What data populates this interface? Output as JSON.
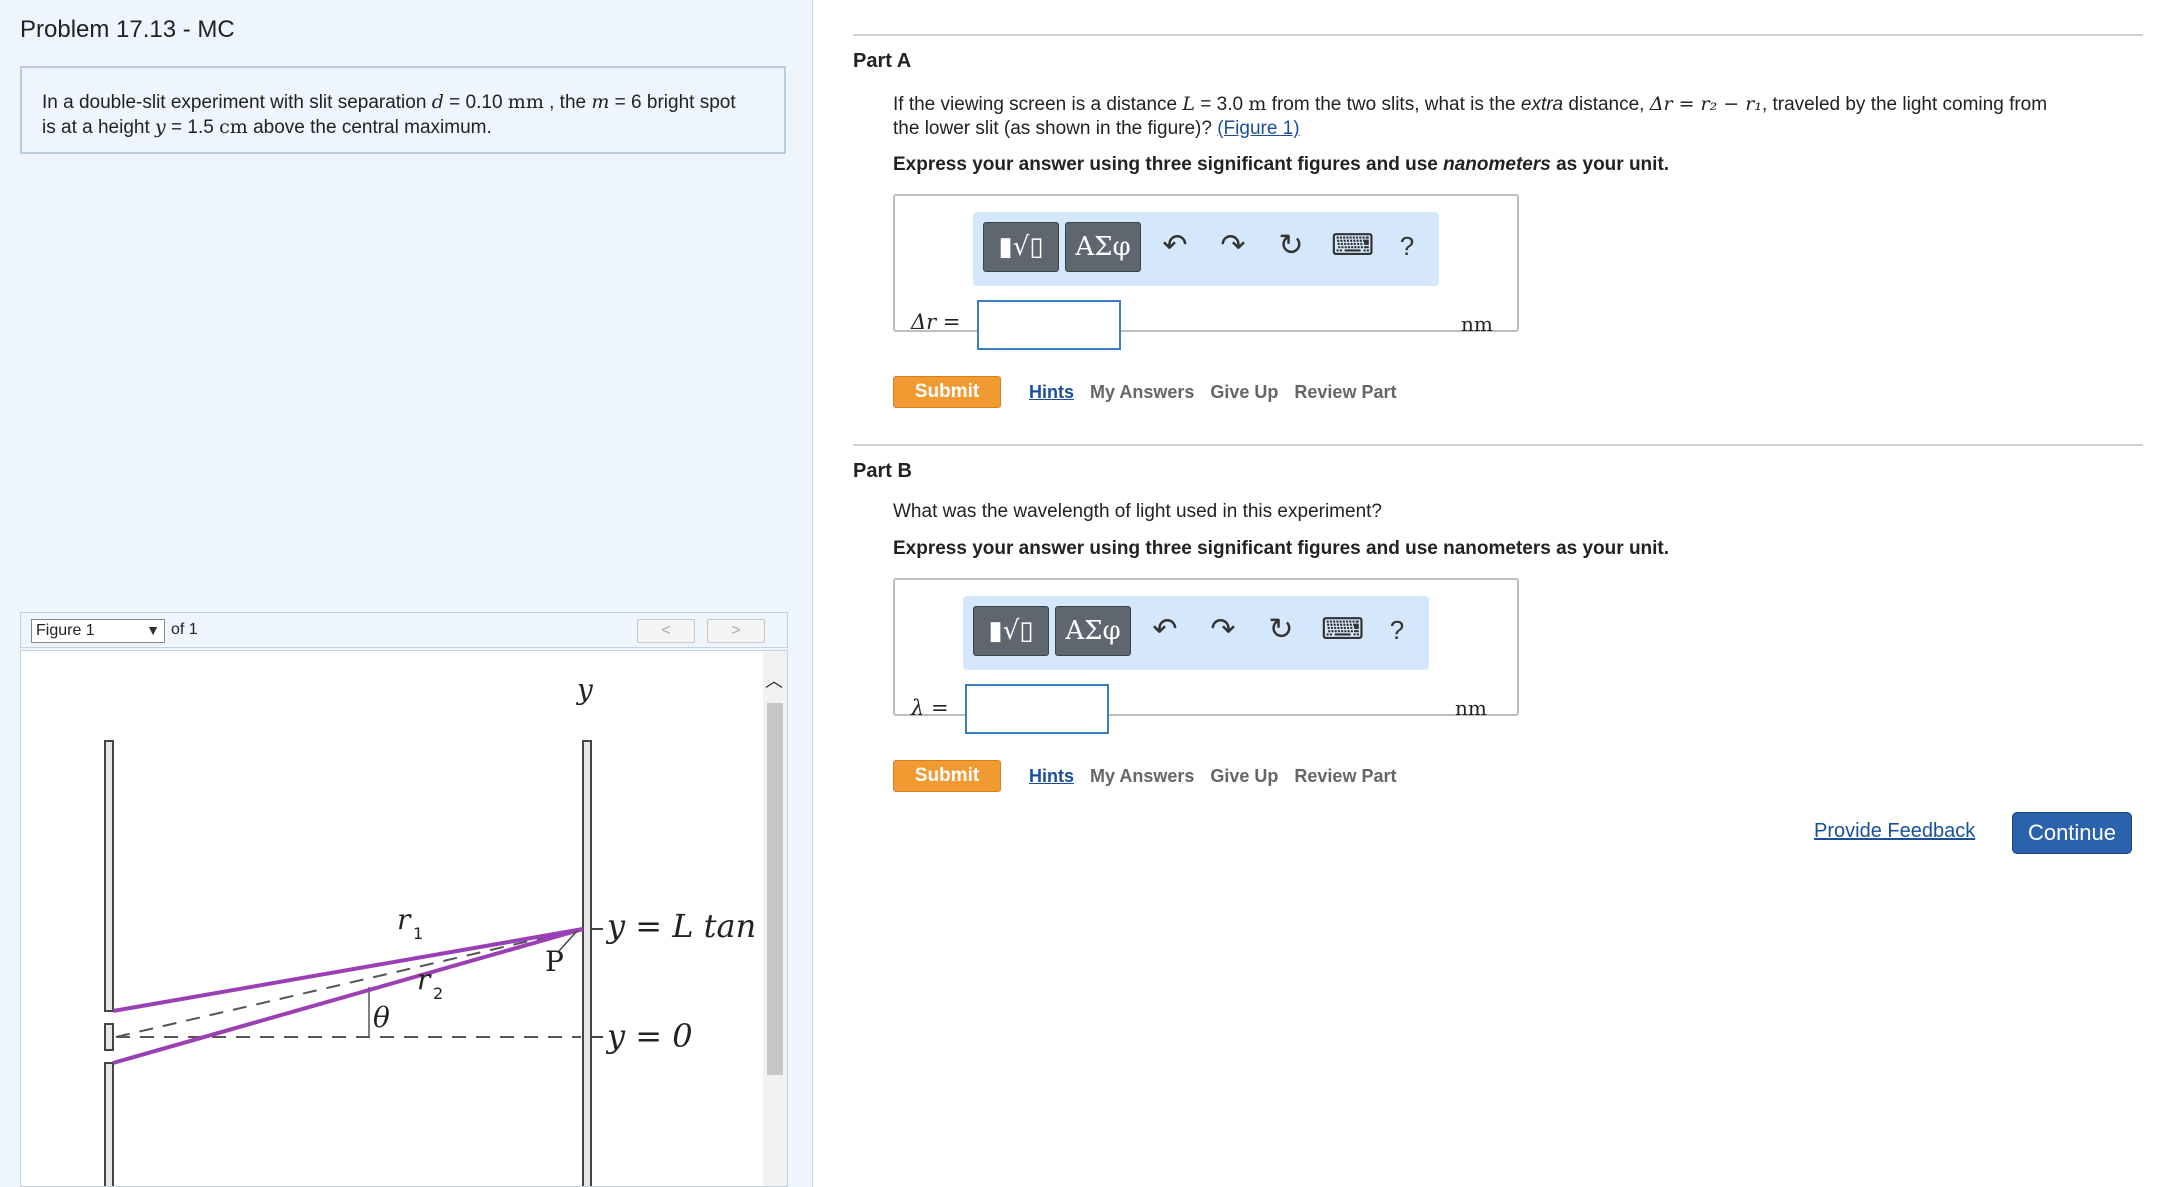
{
  "problem": {
    "title": "Problem 17.13 - MC",
    "statement": {
      "p1": "In a double-slit experiment with slit separation ",
      "d_sym": "d",
      "d_val": " = 0.10 ",
      "d_unit": "mm",
      "p2": " , the ",
      "m_sym": "m",
      "m_val": " = 6 bright spot",
      "p3": "is at a height ",
      "y_sym": "y",
      "y_val": " = 1.5 ",
      "y_unit": "cm",
      "p4": " above the central maximum."
    }
  },
  "figure": {
    "select_value": "Figure 1",
    "of_text": "of 1",
    "prev": "<",
    "next": ">",
    "labels": {
      "y_axis": "y",
      "r1": "r",
      "r1_sub": "1",
      "r2": "r",
      "r2_sub": "2",
      "theta": "θ",
      "p": "P",
      "eq_top": "y = L tan θ",
      "eq_bottom": "y = 0"
    }
  },
  "partA": {
    "heading": "Part A",
    "q1": "If the viewing screen is a distance ",
    "L_sym": "L",
    "L_val": " = 3.0 ",
    "L_unit": "m",
    "q2": " from the two slits, what is the ",
    "extra": "extra",
    "q3": " distance, ",
    "dr_expr": "Δr = r₂ − r₁",
    "q4": ", traveled by the light coming from",
    "q5": "the lower slit  (as shown in the figure)? ",
    "fig_link": "(Figure 1)",
    "instr1": "Express your answer using three significant figures and use ",
    "instr_em": "nanometers",
    "instr2": " as your unit.",
    "label": "Δr =",
    "unit": "nm",
    "submit": "Submit",
    "hints": "Hints",
    "my_answers": "My Answers",
    "give_up": "Give Up",
    "review": "Review Part"
  },
  "partB": {
    "heading": "Part B",
    "question": "What was the wavelength of light used in this experiment?",
    "instr": "Express your answer using three significant figures and use nanometers as your unit.",
    "label": "λ =",
    "unit": "nm",
    "submit": "Submit",
    "hints": "Hints",
    "my_answers": "My Answers",
    "give_up": "Give Up",
    "review": "Review Part"
  },
  "toolbar": {
    "templates": "▮√▯",
    "greek": "ΑΣφ",
    "undo": "↶",
    "redo": "↷",
    "reset": "↻",
    "keyboard": "⌨",
    "help": "?"
  },
  "footer": {
    "feedback": "Provide Feedback",
    "continue": "Continue"
  },
  "colors": {
    "panel_bg": "#eef5fd",
    "submit": "#f29a32",
    "continue": "#2a62ac",
    "ray": "#9b3fb5",
    "toolbar": "#d5e7fb"
  }
}
